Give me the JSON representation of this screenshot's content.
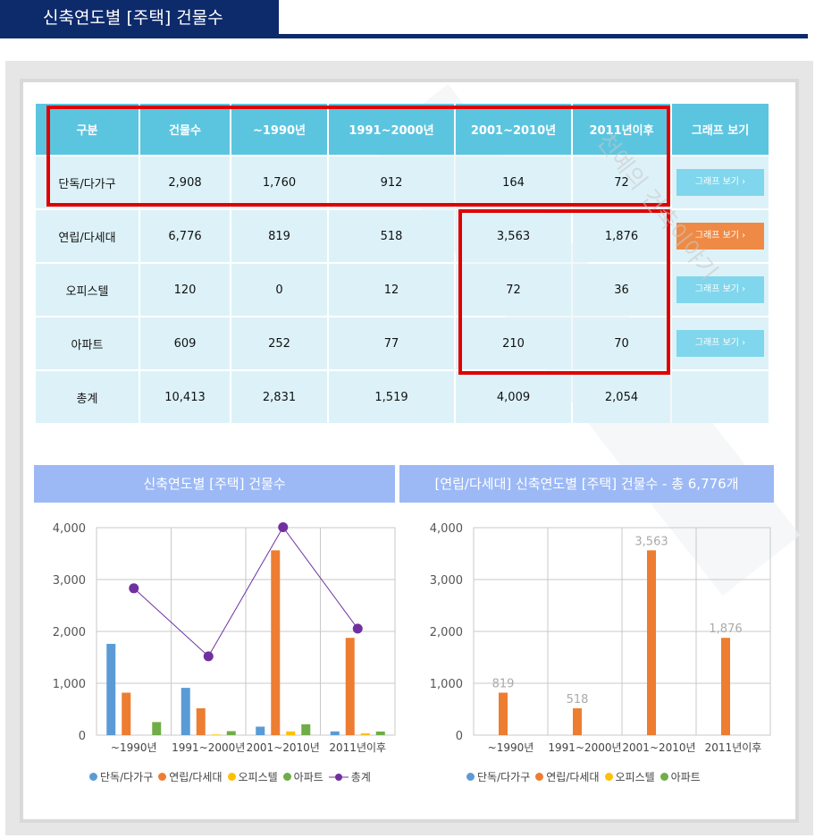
{
  "header": {
    "title": "신축연도별 [주택] 건물수"
  },
  "watermark": "천예의 건축이야기",
  "table": {
    "headers": [
      "구분",
      "건물수",
      "~1990년",
      "1991~2000년",
      "2001~2010년",
      "2011년이후",
      "그래프 보기"
    ],
    "rows": [
      {
        "label": "단독/다가구",
        "cells": [
          "2,908",
          "1,760",
          "912",
          "164",
          "72"
        ],
        "button": "그래프 보기 ›"
      },
      {
        "label": "연립/다세대",
        "cells": [
          "6,776",
          "819",
          "518",
          "3,563",
          "1,876"
        ],
        "button": "그래프 보기 ›"
      },
      {
        "label": "오피스텔",
        "cells": [
          "120",
          "0",
          "12",
          "72",
          "36"
        ],
        "button": "그래프 보기 ›"
      },
      {
        "label": "아파트",
        "cells": [
          "609",
          "252",
          "77",
          "210",
          "70"
        ],
        "button": "그래프 보기 ›"
      },
      {
        "label": "총계",
        "cells": [
          "10,413",
          "2,831",
          "1,519",
          "4,009",
          "2,054"
        ],
        "button": ""
      }
    ]
  },
  "colors": {
    "단독/다가구": "#5b9bd5",
    "연립/다세대": "#ed7d31",
    "오피스텔": "#ffc000",
    "아파트": "#70ad47",
    "총계": "#7030a0"
  },
  "charts": {
    "left": {
      "title": "신축연도별 [주택] 건물수"
    },
    "right": {
      "title": "[연립/다세대] 신축연도별 [주택] 건물수 - 총 6,776개"
    }
  },
  "chart_data": [
    {
      "type": "bar",
      "title": "신축연도별 [주택] 건물수",
      "categories": [
        "~1990년",
        "1991~2000년",
        "2001~2010년",
        "2011년이후"
      ],
      "ylim": [
        0,
        4000
      ],
      "yticks": [
        "0",
        "1,000",
        "2,000",
        "3,000",
        "4,000"
      ],
      "series": [
        {
          "name": "단독/다가구",
          "values": [
            1760,
            912,
            164,
            72
          ]
        },
        {
          "name": "연립/다세대",
          "values": [
            819,
            518,
            3563,
            1876
          ]
        },
        {
          "name": "오피스텔",
          "values": [
            0,
            12,
            72,
            36
          ]
        },
        {
          "name": "아파트",
          "values": [
            252,
            77,
            210,
            70
          ]
        }
      ],
      "line_series": {
        "name": "총계",
        "values": [
          2831,
          1519,
          4009,
          2054
        ]
      },
      "grid": true,
      "legend": "bottom"
    },
    {
      "type": "bar",
      "title": "[연립/다세대] 신축연도별 [주택] 건물수 - 총 6,776개",
      "categories": [
        "~1990년",
        "1991~2000년",
        "2001~2010년",
        "2011년이후"
      ],
      "ylim": [
        0,
        4000
      ],
      "yticks": [
        "0",
        "1,000",
        "2,000",
        "3,000",
        "4,000"
      ],
      "series": [
        {
          "name": "단독/다가구",
          "values": [
            0,
            0,
            0,
            0
          ]
        },
        {
          "name": "연립/다세대",
          "values": [
            819,
            518,
            3563,
            1876
          ],
          "data_labels": [
            "819",
            "518",
            "3,563",
            "1,876"
          ]
        },
        {
          "name": "오피스텔",
          "values": [
            0,
            0,
            0,
            0
          ]
        },
        {
          "name": "아파트",
          "values": [
            0,
            0,
            0,
            0
          ]
        }
      ],
      "grid": true,
      "legend": "bottom"
    }
  ]
}
